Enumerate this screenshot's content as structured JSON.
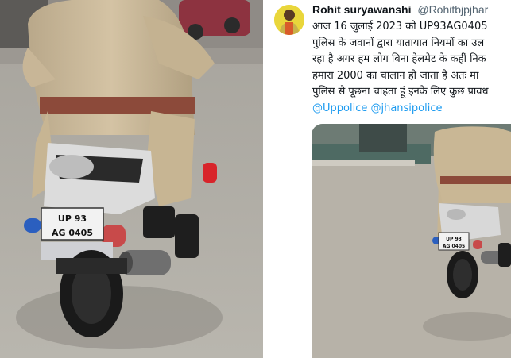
{
  "left_photo": {
    "plate_line1": "UP 93",
    "plate_line2": "AG 0405"
  },
  "tweet": {
    "display_name": "Rohit suryawanshi",
    "handle": "@Rohitbjpjhar",
    "avatar_icon": "profile-photo",
    "text_lines": [
      "आज 16 जुलाई 2023 को UP93AG0405",
      "पुलिस के जवानों द्वारा यातायात नियमों का उल",
      "रहा है अगर हम लोग बिना हेलमेट के कहीं निक",
      "हमारा  2000 का चालान हो  जाता है अतः मा",
      "पुलिस से पूछना चाहता हूं इनके लिए कुछ प्रावध"
    ],
    "mentions": "@Uppolice @jhansipolice",
    "link_color": "#1d9bf0",
    "attached_photo": {
      "plate_line1": "UP 93",
      "plate_line2": "AG 0405"
    }
  }
}
